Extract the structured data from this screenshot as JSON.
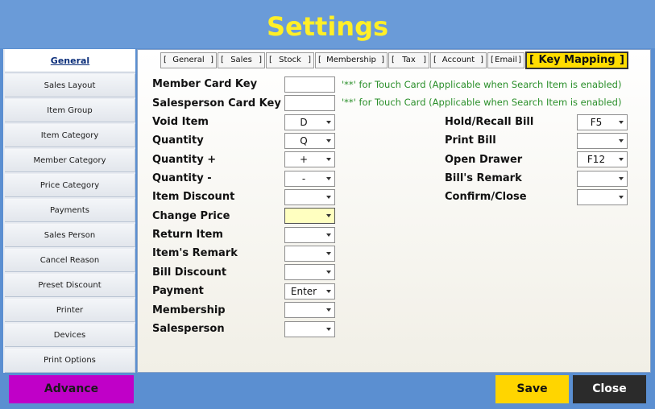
{
  "header": {
    "title": "Settings"
  },
  "sidebar": {
    "items": [
      {
        "label": "General"
      },
      {
        "label": "Sales Layout"
      },
      {
        "label": "Item Group"
      },
      {
        "label": "Item Category"
      },
      {
        "label": "Member Category"
      },
      {
        "label": "Price Category"
      },
      {
        "label": "Payments"
      },
      {
        "label": "Sales Person"
      },
      {
        "label": "Cancel Reason"
      },
      {
        "label": "Preset Discount"
      },
      {
        "label": "Printer"
      },
      {
        "label": "Devices"
      },
      {
        "label": "Print Options"
      }
    ]
  },
  "tabs": [
    {
      "label": "General",
      "open": "[",
      "close": "]"
    },
    {
      "label": "Sales",
      "open": "[",
      "close": "]"
    },
    {
      "label": "Stock",
      "open": "[",
      "close": "]"
    },
    {
      "label": "Membership",
      "open": "[",
      "close": "]"
    },
    {
      "label": "Tax",
      "open": "[",
      "close": "]"
    },
    {
      "label": "Account",
      "open": "[",
      "close": "]"
    },
    {
      "label": "Email",
      "open": "[",
      "close": "]"
    },
    {
      "label": "Key Mapping",
      "open": "[",
      "close": "]"
    }
  ],
  "form": {
    "member_card_key": {
      "label": "Member Card Key",
      "value": "",
      "note": "'**' for Touch Card (Applicable when Search Item is enabled)"
    },
    "salesperson_card_key": {
      "label": "Salesperson Card Key",
      "value": "",
      "note": "'**' for Touch Card (Applicable when Search Item is enabled)"
    },
    "left": [
      {
        "label": "Void Item",
        "value": "D"
      },
      {
        "label": "Quantity",
        "value": "Q"
      },
      {
        "label": "Quantity +",
        "value": "+"
      },
      {
        "label": "Quantity -",
        "value": "-"
      },
      {
        "label": "Item Discount",
        "value": ""
      },
      {
        "label": "Change Price",
        "value": ""
      },
      {
        "label": "Return Item",
        "value": ""
      },
      {
        "label": "Item's Remark",
        "value": ""
      },
      {
        "label": "Bill Discount",
        "value": ""
      },
      {
        "label": "Payment",
        "value": "Enter"
      },
      {
        "label": "Membership",
        "value": ""
      },
      {
        "label": "Salesperson",
        "value": ""
      }
    ],
    "right": [
      {
        "label": "Hold/Recall Bill",
        "value": "F5"
      },
      {
        "label": "Print Bill",
        "value": ""
      },
      {
        "label": "Open Drawer",
        "value": "F12"
      },
      {
        "label": "Bill's Remark",
        "value": ""
      },
      {
        "label": "Confirm/Close",
        "value": ""
      }
    ]
  },
  "footer": {
    "advance_label": "Advance",
    "save_label": "Save",
    "close_label": "Close"
  },
  "colors": {
    "title": "#ffef28",
    "active_tab": "#ffdd00",
    "note_green": "#2a8f2a",
    "advance": "#c000c8",
    "save": "#ffd500",
    "close": "#2b2b2b"
  }
}
